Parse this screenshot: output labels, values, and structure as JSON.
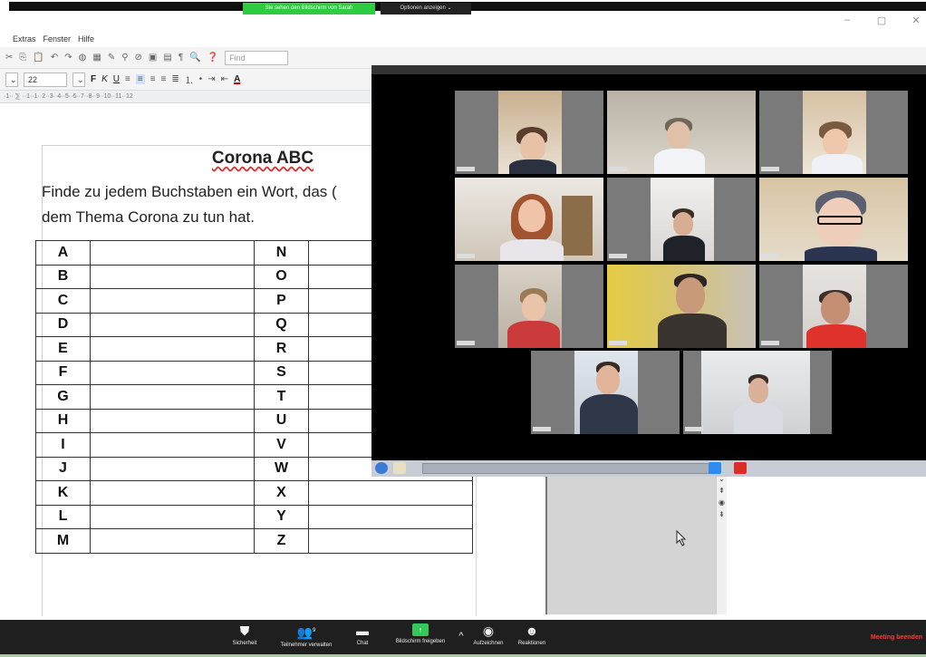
{
  "share_banner": {
    "status_text": "Sie sehen den Bildschirm von Sarah",
    "options_label": "Optionen anzeigen ⌄"
  },
  "window_controls": {
    "minimize": "–",
    "maximize": "▢",
    "close": "✕"
  },
  "menu": {
    "items": [
      "Extras",
      "Fenster",
      "Hilfe"
    ]
  },
  "toolbar": {
    "font_size": "22",
    "search_placeholder": "Find",
    "bold": "F",
    "italic": "K",
    "underline": "U",
    "font_color_letter": "A"
  },
  "ruler": {
    "text": "·1·· ⅀ ··1··1··2··3··4··5··6··7··8··9··10··11··12"
  },
  "document": {
    "title": "Corona ABC",
    "line1": "Finde zu jedem Buchstaben ein Wort, das (",
    "line2": "dem Thema Corona zu tun hat.",
    "letters_left": [
      "A",
      "B",
      "C",
      "D",
      "E",
      "F",
      "G",
      "H",
      "I",
      "J",
      "K",
      "L",
      "M"
    ],
    "letters_right": [
      "N",
      "O",
      "P",
      "Q",
      "R",
      "S",
      "T",
      "U",
      "V",
      "W",
      "X",
      "Y",
      "Z"
    ]
  },
  "zoom_controls": {
    "security": "Sicherheit",
    "participants": "Teilnehmer verwalten",
    "participants_count": "9",
    "chat": "Chat",
    "share": "Bildschirm freigeben",
    "record": "Aufzeichnen",
    "reactions": "Reaktionen",
    "end": "Meeting beenden"
  },
  "scroll_glyphs": {
    "down": "⌄",
    "up_double": "⇞",
    "dot": "◉",
    "down_double": "⇟"
  }
}
